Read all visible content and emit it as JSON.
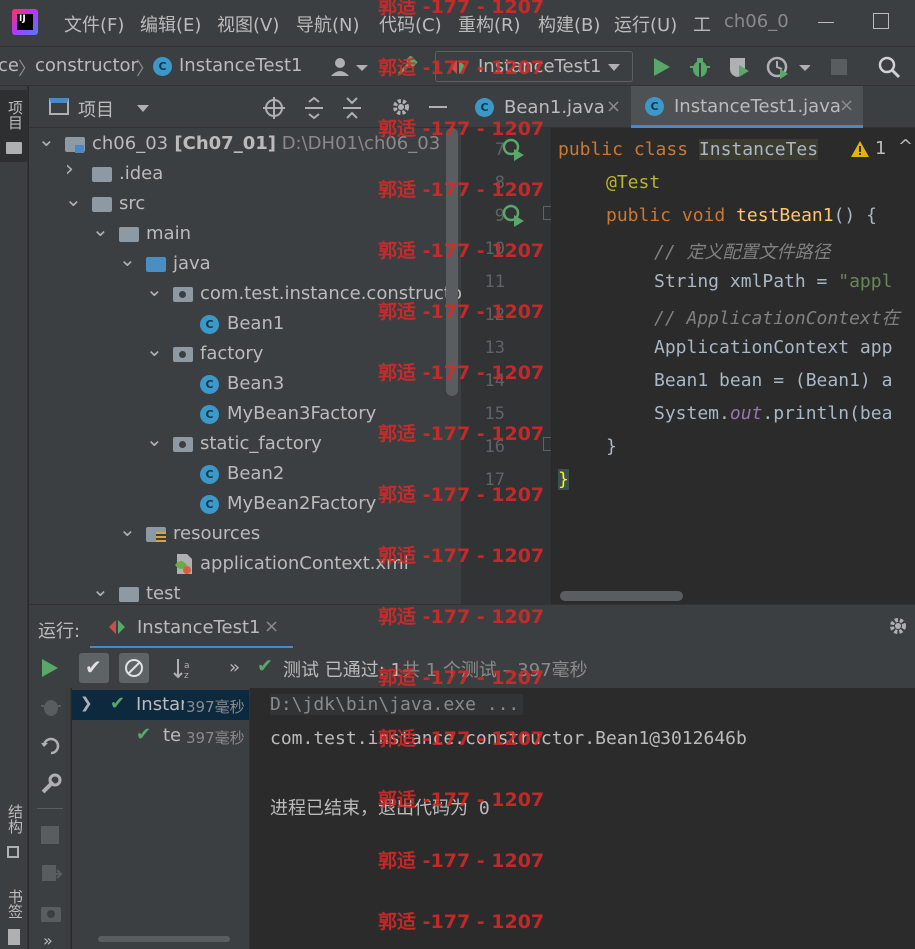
{
  "menu": {
    "items": [
      "文件(F)",
      "编辑(E)",
      "视图(V)",
      "导航(N)",
      "代码(C)",
      "重构(R)",
      "构建(B)",
      "运行(U)",
      "工"
    ],
    "window_title": "ch06_0"
  },
  "breadcrumb": {
    "partial": "ce",
    "package": "constructor",
    "class": "InstanceTest1"
  },
  "run_config": {
    "label": "InstanceTest1"
  },
  "left_stripe": {
    "project": "项目",
    "structure": "结构",
    "bookmarks": "书签"
  },
  "project_panel": {
    "title": "项目",
    "tree": [
      {
        "label": "ch06_03",
        "module": "[Ch07_01]",
        "path": "D:\\DH01\\ch06_03",
        "icon": "module-folder-icon",
        "depth": 0,
        "expanded": true
      },
      {
        "label": ".idea",
        "icon": "folder-icon",
        "depth": 1,
        "expanded": false
      },
      {
        "label": "src",
        "icon": "folder-icon",
        "depth": 1,
        "expanded": true
      },
      {
        "label": "main",
        "icon": "folder-icon",
        "depth": 2,
        "expanded": true
      },
      {
        "label": "java",
        "icon": "source-folder-icon",
        "depth": 3,
        "expanded": true
      },
      {
        "label": "com.test.instance.constructor",
        "icon": "package-icon",
        "depth": 4,
        "expanded": true
      },
      {
        "label": "Bean1",
        "icon": "class-icon",
        "depth": 5
      },
      {
        "label": "factory",
        "icon": "package-icon",
        "depth": 4,
        "expanded": true
      },
      {
        "label": "Bean3",
        "icon": "class-icon",
        "depth": 5
      },
      {
        "label": "MyBean3Factory",
        "icon": "class-icon",
        "depth": 5
      },
      {
        "label": "static_factory",
        "icon": "package-icon",
        "depth": 4,
        "expanded": true
      },
      {
        "label": "Bean2",
        "icon": "class-icon",
        "depth": 5
      },
      {
        "label": "MyBean2Factory",
        "icon": "class-icon",
        "depth": 5
      },
      {
        "label": "resources",
        "icon": "resources-folder-icon",
        "depth": 3,
        "expanded": true
      },
      {
        "label": "applicationContext.xml",
        "icon": "xml-file-icon",
        "depth": 4
      },
      {
        "label": "test",
        "icon": "folder-icon",
        "depth": 2,
        "expanded": true
      }
    ]
  },
  "editor": {
    "tabs": [
      {
        "label": "Bean1.java",
        "active": false
      },
      {
        "label": "InstanceTest1.java",
        "active": true
      }
    ],
    "warning_count": "1",
    "line_numbers": [
      "7",
      "8",
      "9",
      "10",
      "11",
      "12",
      "13",
      "14",
      "15",
      "16",
      "17"
    ],
    "code": {
      "l7a": "public class ",
      "l7b": "InstanceTes",
      "l8": "@Test",
      "l9a": "public void ",
      "l9b": "testBean1",
      "l9c": "() {",
      "l10": "// 定义配置文件路径",
      "l11a": "String xmlPath = ",
      "l11b": "\"appl",
      "l12": "// ApplicationContext在",
      "l13": "ApplicationContext app",
      "l14": "Bean1 bean = (Bean1) a",
      "l15a": "System.",
      "l15b": "out",
      "l15c": ".println(bea",
      "l16": "}",
      "l17": "}"
    }
  },
  "run_panel": {
    "title": "运行:",
    "tab": "InstanceTest1",
    "status_prefix": "测试 已通过: ",
    "status_count": "1",
    "status_suffix": "共 1 个测试 – 397毫秒",
    "tree": [
      {
        "label": "Instar",
        "time": "397毫秒"
      },
      {
        "label": "te:",
        "time": "397毫秒"
      }
    ],
    "console": [
      "D:\\jdk\\bin\\java.exe ...",
      "com.test.instance.constructor.Bean1@3012646b",
      "",
      "进程已结束，退出代码为 0"
    ]
  },
  "watermark": "郭适 -177 - 1207",
  "colors": {
    "accent": "#4a88c7",
    "success": "#59a869",
    "keyword": "#cc7832",
    "watermark": "#dc2828"
  }
}
